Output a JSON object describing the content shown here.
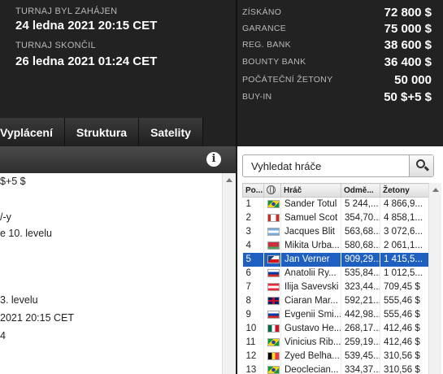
{
  "tournament": {
    "started_label": "TURNAJ BYL ZAHÁJEN",
    "started_value": "24 ledna 2021  20:15 CET",
    "ended_label": "TURNAJ SKONČIL",
    "ended_value": "26 ledna 2021  01:24 CET"
  },
  "stats": [
    {
      "label": "ZÍSKÁNO",
      "value": "72 800 $"
    },
    {
      "label": "GARANCE",
      "value": "75 000 $"
    },
    {
      "label": "REG. BANK",
      "value": "38 600 $"
    },
    {
      "label": "BOUNTY BANK",
      "value": "36 400 $"
    },
    {
      "label": "POČÁTEČNÍ ŽETONY",
      "value": "50 000"
    },
    {
      "label": "BUY-IN",
      "value": "50 $+5 $"
    }
  ],
  "tabs": [
    "Vyplácení",
    "Struktura",
    "Satelity"
  ],
  "info_panel": {
    "lines": [
      "$+5 $",
      "/-y",
      "e 10. levelu",
      "3. levelu",
      "2021  20:15 CET",
      "4"
    ]
  },
  "search": {
    "placeholder": "Vyhledat hráče"
  },
  "players_table": {
    "headers": [
      "Po...",
      "",
      "Hráč",
      "Odmě...",
      "Žetony"
    ],
    "rows": [
      {
        "pos": "1",
        "flag": "brazil",
        "name": "Sander Totul",
        "reward": "5 244,...",
        "chips": "4 866,9..."
      },
      {
        "pos": "2",
        "flag": "canada",
        "name": "Samuel Scot",
        "reward": "354,70...",
        "chips": "4 858,1..."
      },
      {
        "pos": "3",
        "flag": "argentina",
        "name": "Jacques Blit",
        "reward": "563,68...",
        "chips": "3 072,6..."
      },
      {
        "pos": "4",
        "flag": "belarus",
        "name": "Mikita Urba...",
        "reward": "580,68...",
        "chips": "2 061,1..."
      },
      {
        "pos": "5",
        "flag": "czech",
        "name": "Jan Verner",
        "reward": "909,29...",
        "chips": "1 415,5..."
      },
      {
        "pos": "6",
        "flag": "russia",
        "name": "Anatolii Ry...",
        "reward": "535,84...",
        "chips": "1 012,5..."
      },
      {
        "pos": "7",
        "flag": "austria",
        "name": "Ilija Savevski",
        "reward": "323,44...",
        "chips": "709,45 $"
      },
      {
        "pos": "8",
        "flag": "uk",
        "name": "Ciaran Mar...",
        "reward": "592,21...",
        "chips": "555,46 $"
      },
      {
        "pos": "9",
        "flag": "russia",
        "name": "Evgenii Smi...",
        "reward": "442,98...",
        "chips": "555,46 $"
      },
      {
        "pos": "10",
        "flag": "mexico",
        "name": "Gustavo He...",
        "reward": "268,17...",
        "chips": "412,46 $"
      },
      {
        "pos": "11",
        "flag": "brazil",
        "name": "Vinicius Rib...",
        "reward": "259,19...",
        "chips": "412,46 $"
      },
      {
        "pos": "12",
        "flag": "belgium",
        "name": "Zyed Belha...",
        "reward": "539,45...",
        "chips": "310,56 $"
      },
      {
        "pos": "13",
        "flag": "brazil",
        "name": "Deoclecian...",
        "reward": "334,37...",
        "chips": "310,56 $"
      }
    ],
    "selected_row": 4
  }
}
